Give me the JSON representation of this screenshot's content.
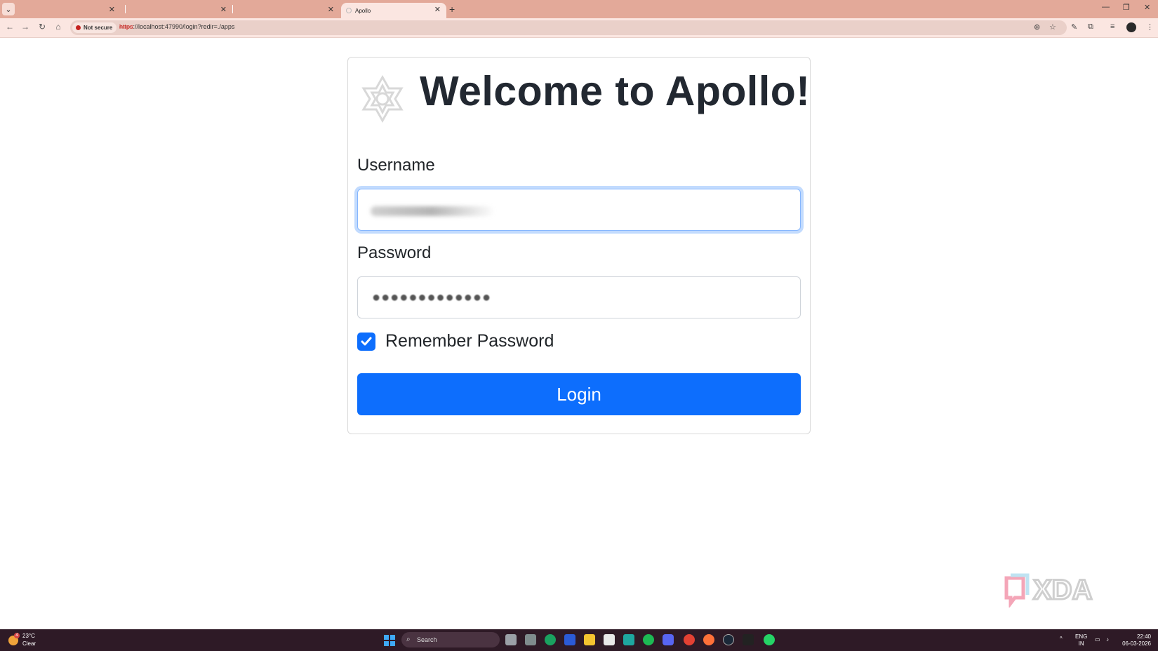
{
  "browser": {
    "tabs": [
      {
        "title": ""
      },
      {
        "title": ""
      },
      {
        "title": ""
      },
      {
        "title": "Apollo"
      }
    ],
    "close_glyph": "✕",
    "new_tab_glyph": "+",
    "security_label": "Not secure",
    "url_protocol": "https",
    "url_rest": "://localhost:47990/login?redir=./apps",
    "window_controls": [
      "—",
      "❐",
      "✕"
    ]
  },
  "page": {
    "title": "Welcome to Apollo!",
    "username_label": "Username",
    "password_label": "Password",
    "password_mask": "●●●●●●●●●●●●●",
    "remember_label": "Remember Password",
    "remember_checked": true,
    "login_button": "Login"
  },
  "watermark": {
    "text": "XDA"
  },
  "taskbar": {
    "weather_temp": "23°C",
    "weather_condition": "Clear",
    "weather_badge": "4",
    "search_placeholder": "Search",
    "language_top": "ENG",
    "language_bottom": "IN",
    "time": "22:40",
    "date": "06-03-2026"
  },
  "colors": {
    "tab_strip": "#e3a999",
    "toolbar": "#fbe6e1",
    "primary": "#0d6efd",
    "taskbar": "#2e1a26"
  }
}
